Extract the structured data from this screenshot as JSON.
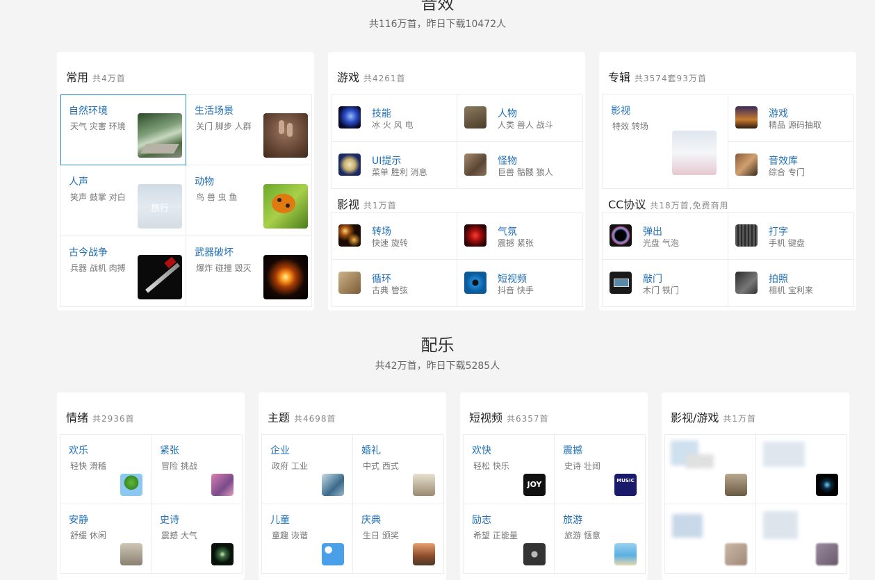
{
  "sfx": {
    "title": "音效",
    "subtitle": "共116万首，昨日下载10472人",
    "common": {
      "title": "常用",
      "count": "共4万首",
      "items": [
        {
          "name": "自然环境",
          "desc": "天气 灾害 环境",
          "icon": "forest-path-thumbnail"
        },
        {
          "name": "生活场景",
          "desc": "关门 脚步 人群",
          "icon": "footprints-sand-thumbnail"
        },
        {
          "name": "人声",
          "desc": "笑声 鼓掌 对白",
          "icon": "sky-travel-thumbnail",
          "thumb_text": "旅行"
        },
        {
          "name": "动物",
          "desc": "鸟 兽 虫 鱼",
          "icon": "ladybug-thumbnail"
        },
        {
          "name": "古今战争",
          "desc": "兵器 战机 肉搏",
          "icon": "sword-thumbnail"
        },
        {
          "name": "武器破坏",
          "desc": "爆炸 碰撞 毁灭",
          "icon": "explosion-thumbnail"
        }
      ]
    },
    "game": {
      "title": "游戏",
      "count": "共4261首",
      "items": [
        {
          "name": "技能",
          "desc": "冰 火 风 电",
          "icon": "skill-swirl-icon"
        },
        {
          "name": "人物",
          "desc": "人类 兽人 战斗",
          "icon": "warrior-icon"
        },
        {
          "name": "UI提示",
          "desc": "菜单 胜利 消息",
          "icon": "ui-dial-icon"
        },
        {
          "name": "怪物",
          "desc": "巨兽 骷髅 狼人",
          "icon": "monster-icon"
        }
      ]
    },
    "film": {
      "title": "影视",
      "count": "共1万首",
      "items": [
        {
          "name": "转场",
          "desc": "快速 旋转",
          "icon": "sparkle-lights-icon"
        },
        {
          "name": "气氛",
          "desc": "震撼 紧张",
          "icon": "red-heart-icon"
        },
        {
          "name": "循环",
          "desc": "古典 管弦",
          "icon": "vintage-icon"
        },
        {
          "name": "短视频",
          "desc": "抖音 快手",
          "icon": "video-lens-icon"
        }
      ]
    },
    "album": {
      "title": "专辑",
      "count": "共3574套93万首",
      "big": {
        "name": "影视",
        "desc": "特效 转场",
        "icon": "fantasy-landscape-thumbnail"
      },
      "items": [
        {
          "name": "游戏",
          "desc": "精品 源码抽取",
          "icon": "game-scene-icon"
        },
        {
          "name": "音效库",
          "desc": "综合 专门",
          "icon": "battle-scene-icon"
        }
      ]
    },
    "cc": {
      "title": "CC协议",
      "count": "共18万首,免费商用",
      "items": [
        {
          "name": "弹出",
          "desc": "光盘 气泡",
          "icon": "bubble-ring-icon"
        },
        {
          "name": "打字",
          "desc": "手机 键盘",
          "icon": "keyboard-icon"
        },
        {
          "name": "敲门",
          "desc": "木门 铁门",
          "icon": "monitor-icon"
        },
        {
          "name": "拍照",
          "desc": "相机 宝利来",
          "icon": "camera-icon"
        }
      ]
    }
  },
  "music": {
    "title": "配乐",
    "subtitle": "共42万首，昨日下载5285人",
    "emotion": {
      "title": "情绪",
      "count": "共2936首",
      "items": [
        {
          "name": "欢乐",
          "desc": "轻快 滑稽",
          "icon": "heart-tree-icon"
        },
        {
          "name": "紧张",
          "desc": "冒险 挑战",
          "icon": "runners-icon"
        },
        {
          "name": "安静",
          "desc": "舒缓 休闲",
          "icon": "love-bird-icon"
        },
        {
          "name": "史诗",
          "desc": "震撼 大气",
          "icon": "light-burst-icon"
        }
      ]
    },
    "theme": {
      "title": "主题",
      "count": "共4698首",
      "items": [
        {
          "name": "企业",
          "desc": "政府 工业",
          "icon": "building-icon"
        },
        {
          "name": "婚礼",
          "desc": "中式 西式",
          "icon": "ring-icon"
        },
        {
          "name": "儿童",
          "desc": "童趣 诙谐",
          "icon": "cartoon-sky-icon"
        },
        {
          "name": "庆典",
          "desc": "生日 颁奖",
          "icon": "balloon-icon"
        }
      ]
    },
    "shortvideo": {
      "title": "短视频",
      "count": "共6357首",
      "items": [
        {
          "name": "欢快",
          "desc": "轻松 快乐",
          "icon": "joy-text-icon",
          "thumb_text": "JOY"
        },
        {
          "name": "震撼",
          "desc": "史诗 壮阔",
          "icon": "music-poster-icon",
          "thumb_text": "MUSIC"
        },
        {
          "name": "励志",
          "desc": "希望 正能量",
          "icon": "badge-icon"
        },
        {
          "name": "旅游",
          "desc": "旅游 惬意",
          "icon": "beach-icon"
        }
      ]
    },
    "filmgame": {
      "title": "影视/游戏",
      "count": "共1万首",
      "items": [
        {
          "icon": "mountain-icon"
        },
        {
          "icon": "dark-space-icon"
        },
        {
          "icon": "blurred-icon"
        },
        {
          "icon": "blurred-icon"
        }
      ]
    }
  },
  "colors": {
    "link": "#1f6fb6",
    "selected_border": "#2b8bc8",
    "background": "#f4f4f4"
  }
}
